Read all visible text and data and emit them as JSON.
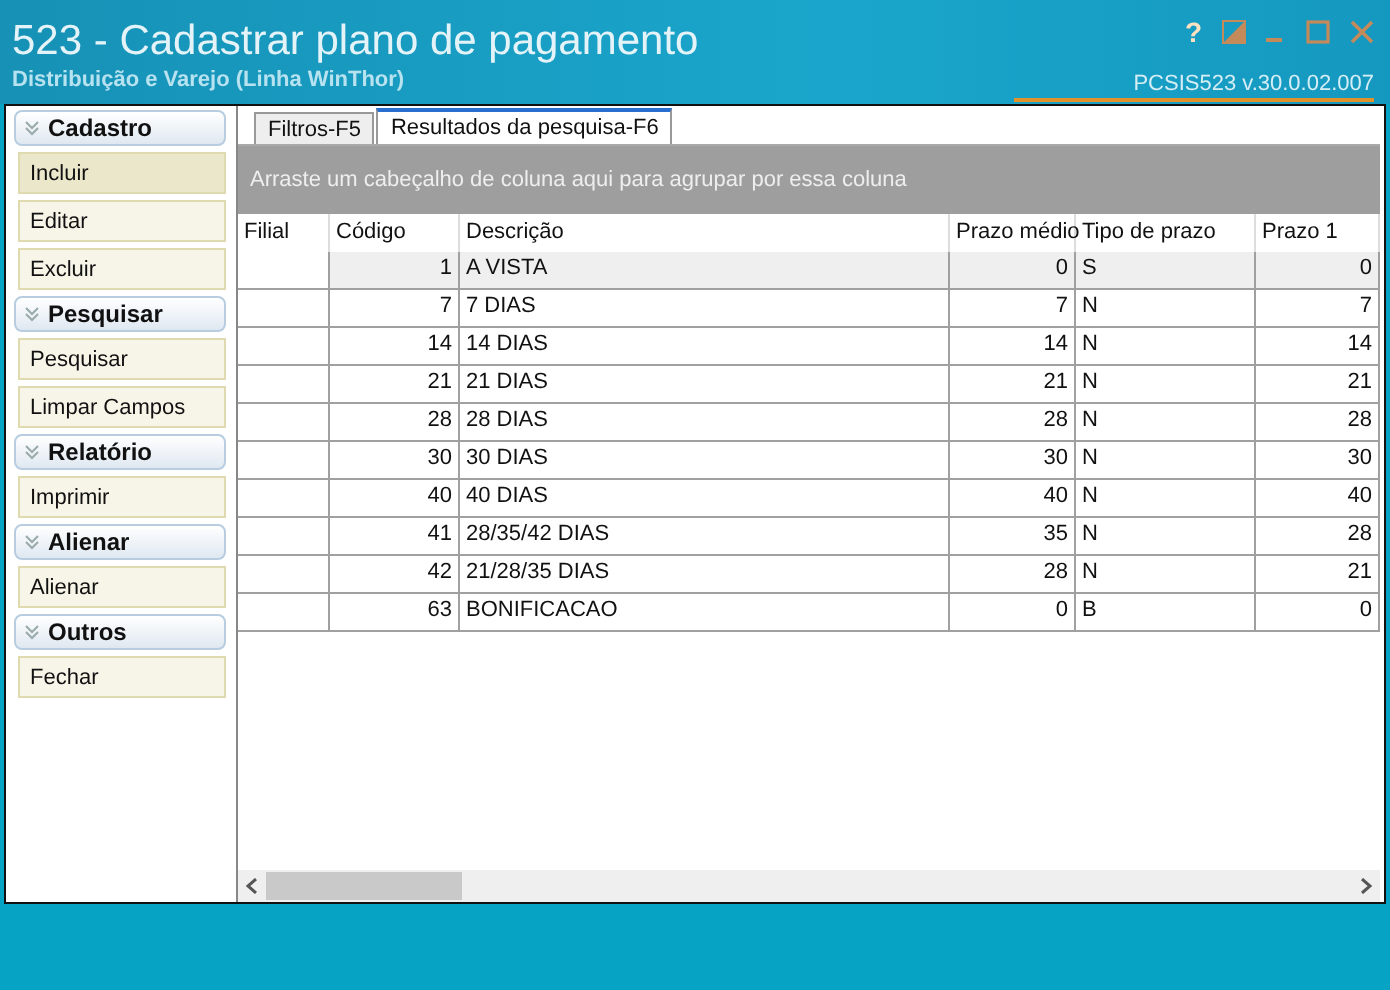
{
  "window": {
    "title": "523 - Cadastrar plano de pagamento",
    "subtitle": "Distribuição e Varejo (Linha WinThor)",
    "version": "PCSIS523  v.30.0.02.007",
    "help": "?"
  },
  "sidebar": {
    "sections": [
      {
        "title": "Cadastro",
        "items": [
          {
            "label": "Incluir",
            "highlighted": true
          },
          {
            "label": "Editar",
            "highlighted": false
          },
          {
            "label": "Excluir",
            "highlighted": false
          }
        ]
      },
      {
        "title": "Pesquisar",
        "items": [
          {
            "label": "Pesquisar",
            "highlighted": false
          },
          {
            "label": "Limpar Campos",
            "highlighted": false
          }
        ]
      },
      {
        "title": "Relatório",
        "items": [
          {
            "label": "Imprimir",
            "highlighted": false
          }
        ]
      },
      {
        "title": "Alienar",
        "items": [
          {
            "label": "Alienar",
            "highlighted": false
          }
        ]
      },
      {
        "title": "Outros",
        "items": [
          {
            "label": "Fechar",
            "highlighted": false
          }
        ]
      }
    ]
  },
  "tabs": [
    {
      "label": "Filtros-F5",
      "selected": false
    },
    {
      "label": "Resultados da pesquisa-F6",
      "selected": true
    }
  ],
  "group_panel": "Arraste um cabeçalho de coluna aqui para agrupar por essa coluna",
  "table": {
    "columns": [
      "Filial",
      "Código",
      "Descrição",
      "Prazo médio",
      "Tipo de prazo",
      "Prazo 1"
    ],
    "rows": [
      {
        "cells": [
          "",
          "1",
          "A VISTA",
          "0",
          "S",
          "0"
        ],
        "selected": true
      },
      {
        "cells": [
          "",
          "7",
          "7 DIAS",
          "7",
          "N",
          "7"
        ],
        "selected": false
      },
      {
        "cells": [
          "",
          "14",
          "14 DIAS",
          "14",
          "N",
          "14"
        ],
        "selected": false
      },
      {
        "cells": [
          "",
          "21",
          "21 DIAS",
          "21",
          "N",
          "21"
        ],
        "selected": false
      },
      {
        "cells": [
          "",
          "28",
          "28 DIAS",
          "28",
          "N",
          "28"
        ],
        "selected": false
      },
      {
        "cells": [
          "",
          "30",
          "30 DIAS",
          "30",
          "N",
          "30"
        ],
        "selected": false
      },
      {
        "cells": [
          "",
          "40",
          "40 DIAS",
          "40",
          "N",
          "40"
        ],
        "selected": false
      },
      {
        "cells": [
          "",
          "41",
          "28/35/42 DIAS",
          "35",
          "N",
          "28"
        ],
        "selected": false
      },
      {
        "cells": [
          "",
          "42",
          "21/28/35 DIAS",
          "28",
          "N",
          "21"
        ],
        "selected": false
      },
      {
        "cells": [
          "",
          "63",
          "BONIFICACAO",
          "0",
          "B",
          "0"
        ],
        "selected": false
      }
    ]
  }
}
